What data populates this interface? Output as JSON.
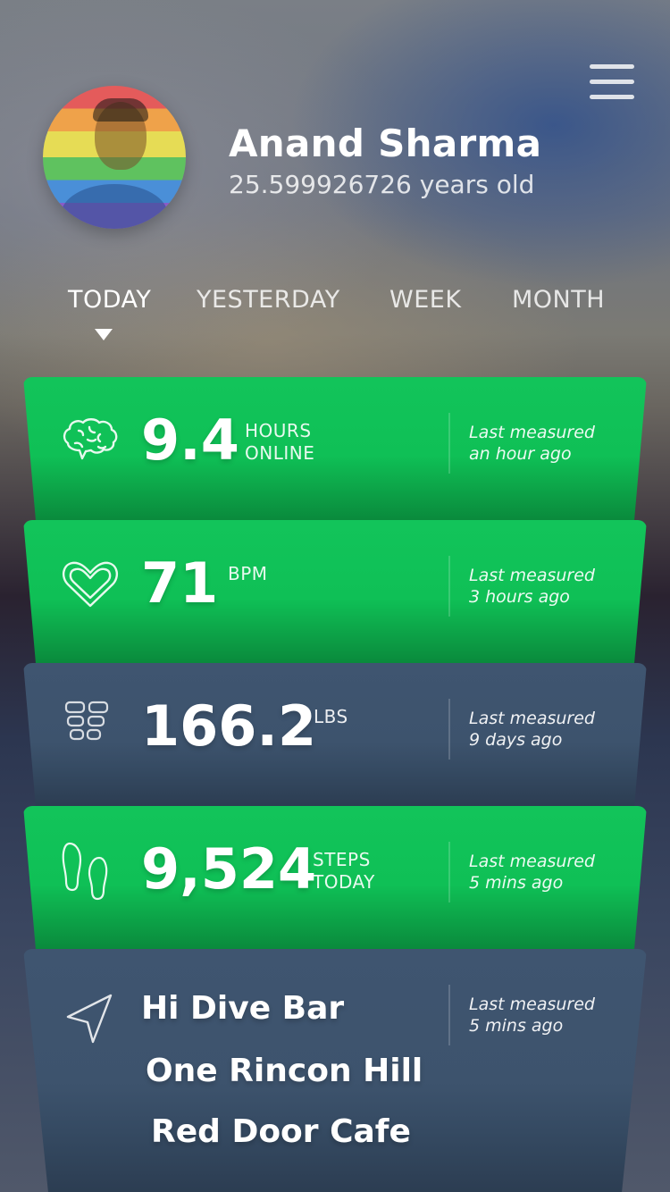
{
  "profile": {
    "name": "Anand Sharma",
    "age": "25.599926726 years old"
  },
  "tabs": [
    {
      "label": "TODAY",
      "active": true
    },
    {
      "label": "YESTERDAY",
      "active": false
    },
    {
      "label": "WEEK",
      "active": false
    },
    {
      "label": "MONTH",
      "active": false
    }
  ],
  "cards": [
    {
      "icon": "brain-icon",
      "value": "9.4",
      "unit_line1": "HOURS",
      "unit_line2": "ONLINE",
      "measured_line1": "Last measured",
      "measured_line2": "an hour ago",
      "color": "#12c45a"
    },
    {
      "icon": "heart-icon",
      "value": "71",
      "unit_line1": "BPM",
      "unit_line2": "",
      "measured_line1": "Last measured",
      "measured_line2": "3 hours ago",
      "color": "#12c45a"
    },
    {
      "icon": "scale-grid-icon",
      "value": "166.2",
      "unit_line1": "LBS",
      "unit_line2": "",
      "measured_line1": "Last measured",
      "measured_line2": "9 days ago",
      "color": "#3f5570"
    },
    {
      "icon": "footprints-icon",
      "value": "9,524",
      "unit_line1": "STEPS",
      "unit_line2": "TODAY",
      "measured_line1": "Last measured",
      "measured_line2": "5 mins ago",
      "color": "#12c45a"
    },
    {
      "icon": "location-arrow-icon",
      "places": [
        "Hi Dive Bar",
        "One Rincon Hill",
        "Red Door Cafe"
      ],
      "measured_line1": "Last measured",
      "measured_line2": "5 mins ago",
      "color": "#3f5570"
    }
  ]
}
